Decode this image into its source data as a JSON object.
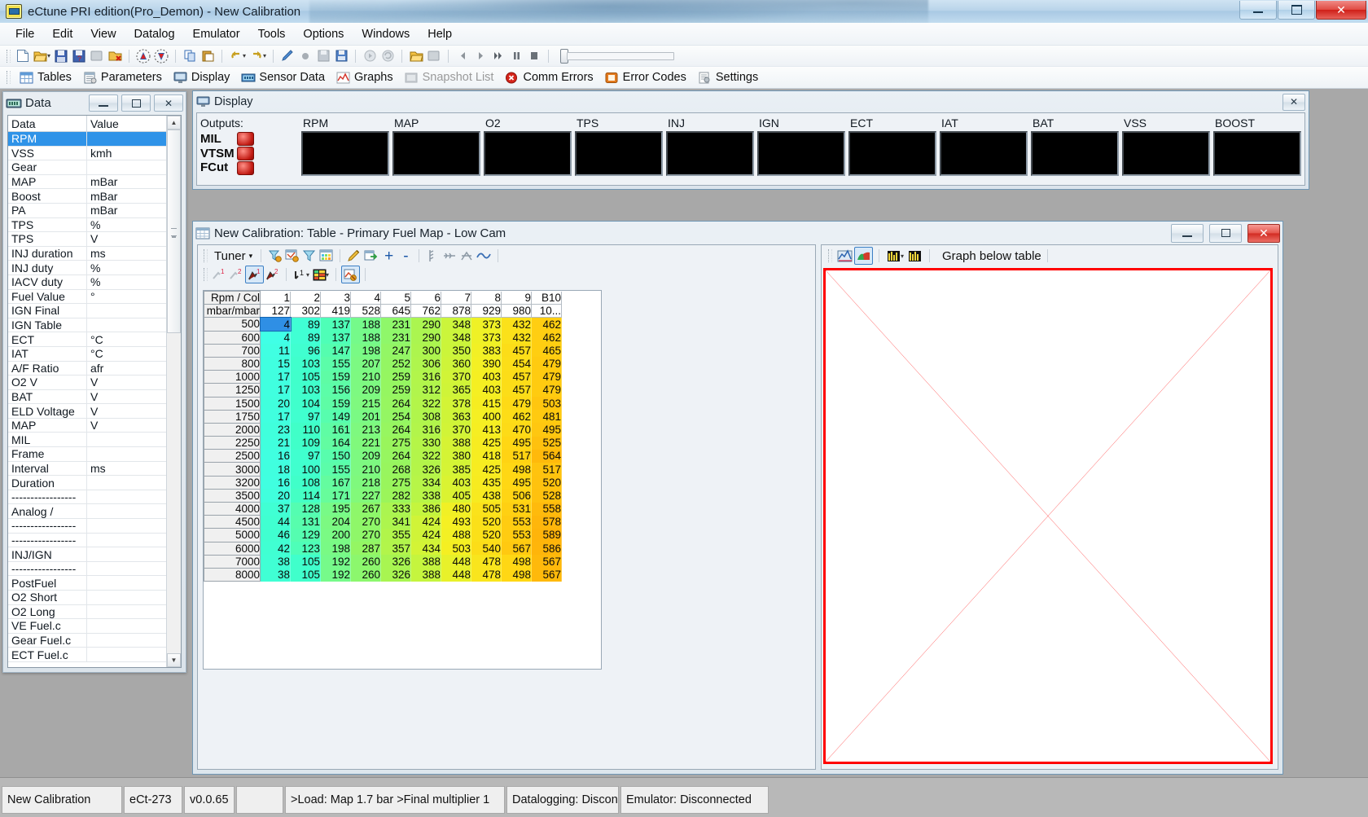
{
  "window": {
    "title": "eCtune PRI edition(Pro_Demon) - New Calibration",
    "minimize": "—",
    "maximize": "❐",
    "close": "✕"
  },
  "menu": [
    "File",
    "Edit",
    "View",
    "Datalog",
    "Emulator",
    "Tools",
    "Options",
    "Windows",
    "Help"
  ],
  "toolbar_tabs": [
    {
      "label": "Tables",
      "icon": "table-icon",
      "dim": false
    },
    {
      "label": "Parameters",
      "icon": "parameters-icon",
      "dim": false
    },
    {
      "label": "Display",
      "icon": "monitor-icon",
      "dim": false
    },
    {
      "label": "Sensor Data",
      "icon": "sensor-icon",
      "dim": false
    },
    {
      "label": "Graphs",
      "icon": "graph-icon",
      "dim": false
    },
    {
      "label": "Snapshot List",
      "icon": "snapshot-icon",
      "dim": true
    },
    {
      "label": "Comm Errors",
      "icon": "comm-error-icon",
      "dim": false
    },
    {
      "label": "Error Codes",
      "icon": "error-codes-icon",
      "dim": false
    },
    {
      "label": "Settings",
      "icon": "settings-icon",
      "dim": false
    }
  ],
  "data_window": {
    "title": "Data",
    "columns": [
      "Data",
      "Value"
    ],
    "selected_index": 0,
    "rows": [
      {
        "name": "RPM",
        "value": ""
      },
      {
        "name": "VSS",
        "value": "kmh"
      },
      {
        "name": "Gear",
        "value": ""
      },
      {
        "name": "MAP",
        "value": "mBar"
      },
      {
        "name": "Boost",
        "value": "mBar"
      },
      {
        "name": "PA",
        "value": "mBar"
      },
      {
        "name": "TPS",
        "value": "%"
      },
      {
        "name": "TPS",
        "value": "V"
      },
      {
        "name": "INJ duration",
        "value": "ms"
      },
      {
        "name": "INJ duty",
        "value": "%"
      },
      {
        "name": "IACV duty",
        "value": "%"
      },
      {
        "name": "Fuel Value",
        "value": "°"
      },
      {
        "name": "IGN Final",
        "value": ""
      },
      {
        "name": "IGN Table",
        "value": ""
      },
      {
        "name": "ECT",
        "value": "°C"
      },
      {
        "name": "IAT",
        "value": "°C"
      },
      {
        "name": "A/F Ratio",
        "value": "afr"
      },
      {
        "name": "O2 V",
        "value": "V"
      },
      {
        "name": "BAT",
        "value": "V"
      },
      {
        "name": "ELD Voltage",
        "value": "V"
      },
      {
        "name": "MAP",
        "value": "V"
      },
      {
        "name": "MIL",
        "value": ""
      },
      {
        "name": "Frame",
        "value": ""
      },
      {
        "name": "Interval",
        "value": "ms"
      },
      {
        "name": "Duration",
        "value": ""
      },
      {
        "name": "-----------------",
        "value": ""
      },
      {
        "name": "Analog /",
        "value": ""
      },
      {
        "name": "-----------------",
        "value": ""
      },
      {
        "name": "-----------------",
        "value": ""
      },
      {
        "name": "INJ/IGN",
        "value": ""
      },
      {
        "name": "-----------------",
        "value": ""
      },
      {
        "name": "PostFuel",
        "value": ""
      },
      {
        "name": "O2 Short",
        "value": ""
      },
      {
        "name": "O2 Long",
        "value": ""
      },
      {
        "name": "VE Fuel.c",
        "value": ""
      },
      {
        "name": "Gear Fuel.c",
        "value": ""
      },
      {
        "name": "ECT Fuel.c",
        "value": ""
      }
    ]
  },
  "display_window": {
    "title": "Display",
    "outputs_label": "Outputs:",
    "outputs": [
      "MIL",
      "VTSM",
      "FCut"
    ],
    "channels": [
      "RPM",
      "MAP",
      "O2",
      "TPS",
      "INJ",
      "IGN",
      "ECT",
      "IAT",
      "BAT",
      "VSS",
      "BOOST"
    ]
  },
  "calibration_window": {
    "title": "New Calibration: Table - Primary Fuel Map - Low Cam",
    "minimize": "—",
    "maximize": "❐",
    "close": "✕",
    "toolbar": {
      "tuner_label": "Tuner",
      "dropdown_caret": "▾",
      "plus": "+",
      "minus": "-"
    },
    "graph_toolbar_label": "Graph below table"
  },
  "chart_data": {
    "type": "heatmap",
    "title": "Primary Fuel Map - Low Cam",
    "xlabel": "mbar/mbar",
    "ylabel": "Rpm / Col",
    "corner_top": "Rpm / Col",
    "corner_bottom": "mbar/mbar",
    "col_indices": [
      "1",
      "2",
      "3",
      "4",
      "5",
      "6",
      "7",
      "8",
      "9",
      "B10"
    ],
    "col_values": [
      "127",
      "302",
      "419",
      "528",
      "645",
      "762",
      "878",
      "929",
      "980",
      "10..."
    ],
    "row_labels": [
      "500",
      "600",
      "700",
      "800",
      "1000",
      "1250",
      "1500",
      "1750",
      "2000",
      "2250",
      "2500",
      "3000",
      "3200",
      "3500",
      "4000",
      "4500",
      "5000",
      "6000",
      "7000",
      "8000"
    ],
    "selected_cell": {
      "row": 0,
      "col": 0
    },
    "values": [
      [
        4,
        89,
        137,
        188,
        231,
        290,
        348,
        373,
        432,
        462
      ],
      [
        4,
        89,
        137,
        188,
        231,
        290,
        348,
        373,
        432,
        462
      ],
      [
        11,
        96,
        147,
        198,
        247,
        300,
        350,
        383,
        457,
        465
      ],
      [
        15,
        103,
        155,
        207,
        252,
        306,
        360,
        390,
        454,
        479
      ],
      [
        17,
        105,
        159,
        210,
        259,
        316,
        370,
        403,
        457,
        479
      ],
      [
        17,
        103,
        156,
        209,
        259,
        312,
        365,
        403,
        457,
        479
      ],
      [
        20,
        104,
        159,
        215,
        264,
        322,
        378,
        415,
        479,
        503
      ],
      [
        17,
        97,
        149,
        201,
        254,
        308,
        363,
        400,
        462,
        481
      ],
      [
        23,
        110,
        161,
        213,
        264,
        316,
        370,
        413,
        470,
        495
      ],
      [
        21,
        109,
        164,
        221,
        275,
        330,
        388,
        425,
        495,
        525
      ],
      [
        16,
        97,
        150,
        209,
        264,
        322,
        380,
        418,
        517,
        564
      ],
      [
        18,
        100,
        155,
        210,
        268,
        326,
        385,
        425,
        498,
        517
      ],
      [
        16,
        108,
        167,
        218,
        275,
        334,
        403,
        435,
        495,
        520
      ],
      [
        20,
        114,
        171,
        227,
        282,
        338,
        405,
        438,
        506,
        528
      ],
      [
        37,
        128,
        195,
        267,
        333,
        386,
        480,
        505,
        531,
        558
      ],
      [
        44,
        131,
        204,
        270,
        341,
        424,
        493,
        520,
        553,
        578
      ],
      [
        46,
        129,
        200,
        270,
        355,
        424,
        488,
        520,
        553,
        589
      ],
      [
        42,
        123,
        198,
        287,
        357,
        434,
        503,
        540,
        567,
        586
      ],
      [
        38,
        105,
        192,
        260,
        326,
        388,
        448,
        478,
        498,
        567
      ],
      [
        38,
        105,
        192,
        260,
        326,
        388,
        448,
        478,
        498,
        567
      ]
    ],
    "color_scale": {
      "min_color": "#00ffe6",
      "mid_color": "#7cf542",
      "high_color": "#ffff00",
      "max_color": "#ffb300",
      "selected_color": "#2f8fe5"
    }
  },
  "status_bar": {
    "cells": [
      "New Calibration",
      "eCt-273",
      "v0.0.65",
      "",
      ">Load: Map 1.7 bar >Final multiplier 1",
      "Datalogging: Discon",
      "Emulator: Disconnected"
    ]
  }
}
